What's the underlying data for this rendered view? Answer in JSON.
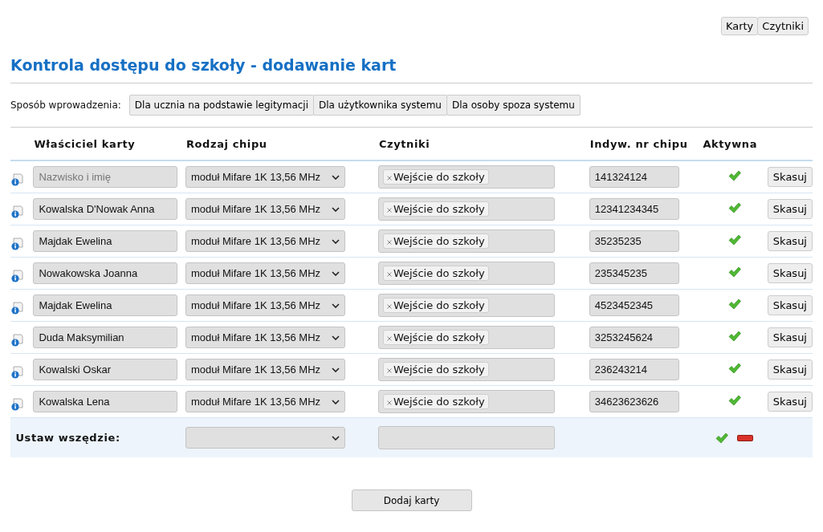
{
  "nav_buttons": [
    "Karty",
    "Czytniki"
  ],
  "title": "Kontrola dostępu do szkoły - dodawanie kart",
  "method": {
    "label": "Sposób wprowadzenia:",
    "options": [
      "Dla ucznia na podstawie legitymacji",
      "Dla użytkownika systemu",
      "Dla osoby spoza systemu"
    ]
  },
  "table": {
    "columns": [
      "Właściciel karty",
      "Rodzaj chipu",
      "Czytniki",
      "Indyw. nr chipu",
      "Aktywna"
    ],
    "rows": [
      {
        "owner": "",
        "owner_placeholder": "Nazwisko i imię",
        "chip": "moduł Mifare 1K 13,56 MHz",
        "readers": [
          "Wejście do szkoły"
        ],
        "number": "141324124",
        "active": true,
        "delete": "Skasuj"
      },
      {
        "owner": "Kowalska D'Nowak Anna",
        "chip": "moduł Mifare 1K 13,56 MHz",
        "readers": [
          "Wejście do szkoły"
        ],
        "number": "12341234345",
        "active": true,
        "delete": "Skasuj"
      },
      {
        "owner": "Majdak Ewelina",
        "chip": "moduł Mifare 1K 13,56 MHz",
        "readers": [
          "Wejście do szkoły"
        ],
        "number": "35235235",
        "active": true,
        "delete": "Skasuj"
      },
      {
        "owner": "Nowakowska Joanna",
        "chip": "moduł Mifare 1K 13,56 MHz",
        "readers": [
          "Wejście do szkoły"
        ],
        "number": "235345235",
        "active": true,
        "delete": "Skasuj"
      },
      {
        "owner": "Majdak Ewelina",
        "chip": "moduł Mifare 1K 13,56 MHz",
        "readers": [
          "Wejście do szkoły"
        ],
        "number": "4523452345",
        "active": true,
        "delete": "Skasuj"
      },
      {
        "owner": "Duda Maksymilian",
        "chip": "moduł Mifare 1K 13,56 MHz",
        "readers": [
          "Wejście do szkoły"
        ],
        "number": "3253245624",
        "active": true,
        "delete": "Skasuj"
      },
      {
        "owner": "Kowalski Oskar",
        "chip": "moduł Mifare 1K 13,56 MHz",
        "readers": [
          "Wejście do szkoły"
        ],
        "number": "236243214",
        "active": true,
        "delete": "Skasuj"
      },
      {
        "owner": "Kowalska Lena",
        "chip": "moduł Mifare 1K 13,56 MHz",
        "readers": [
          "Wejście do szkoły"
        ],
        "number": "34623623626",
        "active": true,
        "delete": "Skasuj"
      }
    ],
    "footer": {
      "label": "Ustaw wszędzie:"
    }
  },
  "submit": "Dodaj karty"
}
